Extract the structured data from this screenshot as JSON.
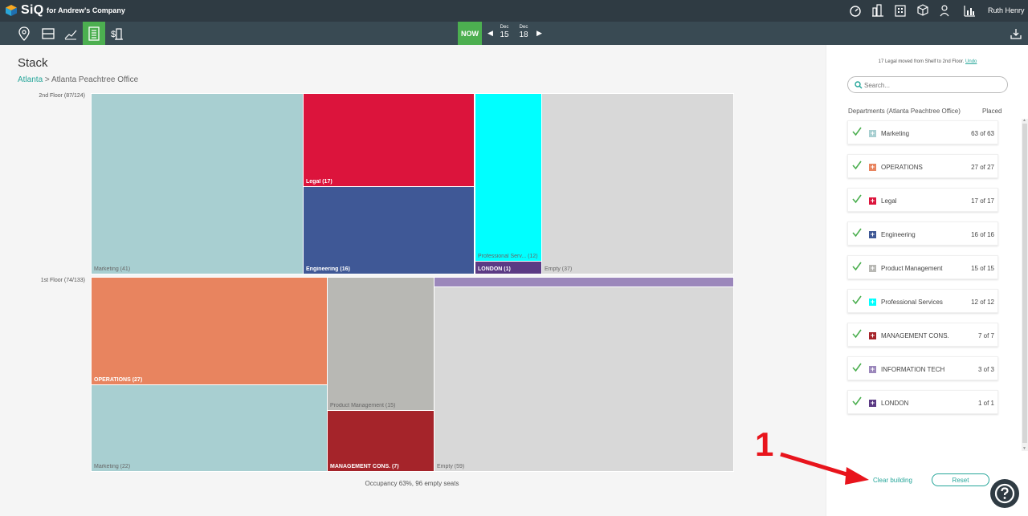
{
  "app": {
    "brand": "SiQ",
    "company": "for Andrew's Company",
    "user": "Ruth Henry"
  },
  "timeline": {
    "now_label": "NOW",
    "dates": [
      {
        "month": "Dec",
        "day": "15"
      },
      {
        "month": "Dec",
        "day": "18"
      }
    ]
  },
  "page": {
    "title": "Stack",
    "breadcrumb_root": "Atlanta",
    "breadcrumb_sep": ">",
    "breadcrumb_current": "Atlanta Peachtree Office",
    "occupancy": "Occupancy 63%, 96 empty seats"
  },
  "floors": [
    {
      "label": "2nd Floor (87/124)"
    },
    {
      "label": "1st Floor (74/133)"
    }
  ],
  "blocks": {
    "f2_marketing": "Marketing (41)",
    "f2_legal": "Legal (17)",
    "f2_engineering": "Engineering (16)",
    "f2_professional": "Professional Serv... (12)",
    "f2_london": "LONDON (1)",
    "f2_empty": "Empty (37)",
    "f1_operations": "OPERATIONS (27)",
    "f1_marketing": "Marketing (22)",
    "f1_product": "Product Management (15)",
    "f1_management": "MANAGEMENT CONS. (7)",
    "f1_empty": "Empty (59)"
  },
  "sidebar": {
    "notice": "17 Legal moved from Shelf to 2nd Floor.",
    "undo": "Undo",
    "search_placeholder": "Search...",
    "dept_header": "Departments (Atlanta Peachtree Office)",
    "placed_header": "Placed",
    "departments": [
      {
        "name": "Marketing",
        "placed": "63 of 63",
        "color": "#a8cfd1"
      },
      {
        "name": "OPERATIONS",
        "placed": "27 of 27",
        "color": "#e8845f"
      },
      {
        "name": "Legal",
        "placed": "17 of 17",
        "color": "#dc143c"
      },
      {
        "name": "Engineering",
        "placed": "16 of 16",
        "color": "#3f5896"
      },
      {
        "name": "Product Management",
        "placed": "15 of 15",
        "color": "#b8b8b4"
      },
      {
        "name": "Professional Services",
        "placed": "12 of 12",
        "color": "#00ffff"
      },
      {
        "name": "MANAGEMENT CONS.",
        "placed": "7 of 7",
        "color": "#a5242a"
      },
      {
        "name": "INFORMATION TECH",
        "placed": "3 of 3",
        "color": "#9b87bb"
      },
      {
        "name": "LONDON",
        "placed": "1 of 1",
        "color": "#5b3a84"
      }
    ],
    "clear_building": "Clear building",
    "reset": "Reset"
  },
  "annotation": {
    "number": "1"
  }
}
